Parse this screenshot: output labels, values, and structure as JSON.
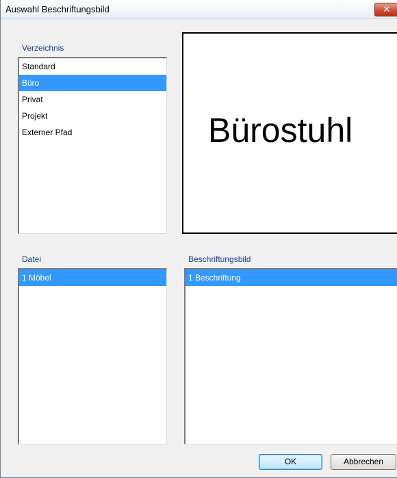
{
  "window": {
    "title": "Auswahl Beschriftungsbild",
    "close_label": "✕"
  },
  "directory": {
    "label": "Verzeichnis",
    "items": [
      "Standard",
      "Büro",
      "Privat",
      "Projekt",
      "Externer Pfad"
    ],
    "selected": "Büro"
  },
  "preview": {
    "text": "Bürostuhl"
  },
  "file": {
    "label": "Datei",
    "items": [
      "1 Möbel"
    ],
    "selected": "1 Möbel"
  },
  "label_image": {
    "label": "Beschriftungsbild",
    "items": [
      "1 Beschriftung"
    ],
    "selected": "1 Beschriftung"
  },
  "buttons": {
    "ok": "OK",
    "cancel": "Abbrechen"
  },
  "colors": {
    "selection": "#3399ff",
    "group_label": "#1c3d8c",
    "dialog_background": "#f0f0f0"
  }
}
